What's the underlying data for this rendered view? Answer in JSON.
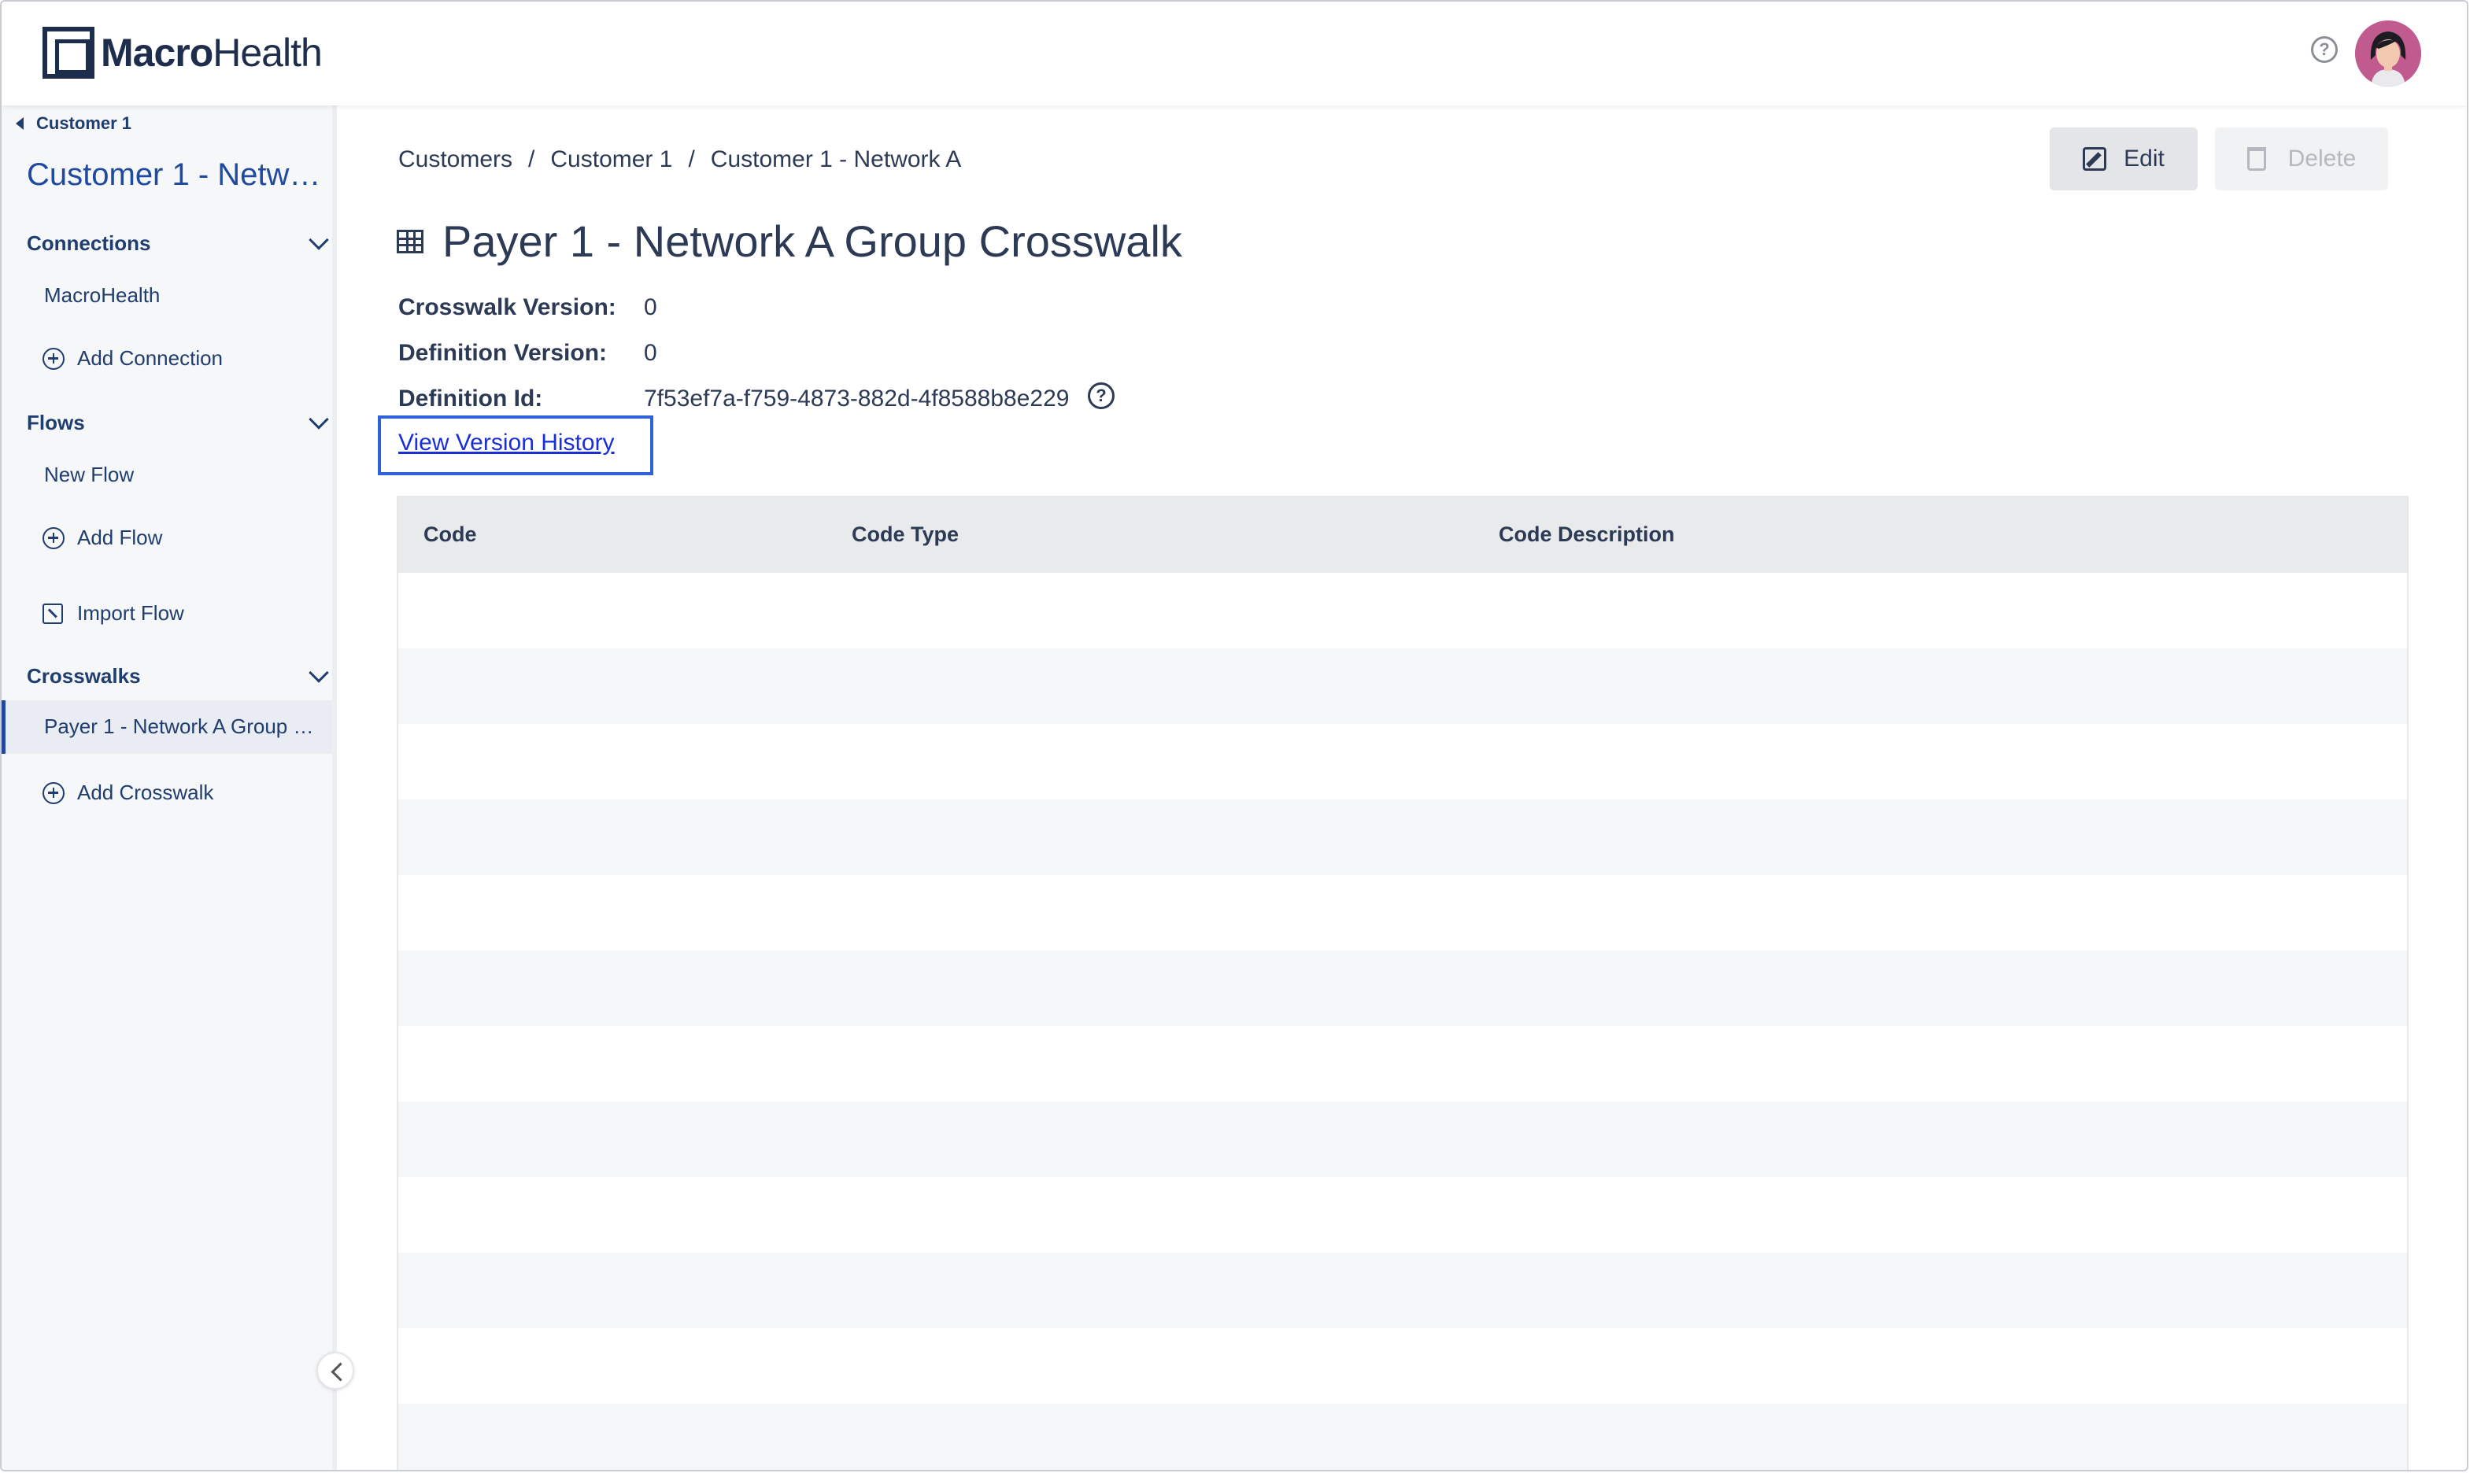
{
  "app": {
    "logo_bold": "Macro",
    "logo_rest": "Health"
  },
  "sidebar": {
    "back_label": "Customer 1",
    "title": "Customer 1 - Network A",
    "sections": {
      "connections": "Connections",
      "flows": "Flows",
      "crosswalks": "Crosswalks"
    },
    "connections_items": [
      "MacroHealth"
    ],
    "add_connection": "Add Connection",
    "flows_items": [
      "New Flow"
    ],
    "add_flow": "Add Flow",
    "import_flow": "Import Flow",
    "crosswalk_items": [
      "Payer 1 - Network A Group Crosswalk"
    ],
    "add_crosswalk": "Add Crosswalk"
  },
  "breadcrumb": [
    "Customers",
    "Customer 1",
    "Customer 1 - Network A"
  ],
  "toolbar": {
    "edit_label": "Edit",
    "delete_label": "Delete"
  },
  "page": {
    "title": "Payer 1 - Network A Group Crosswalk",
    "crosswalk_version_label": "Crosswalk Version:",
    "crosswalk_version": "0",
    "definition_version_label": "Definition Version:",
    "definition_version": "0",
    "definition_id_label": "Definition Id:",
    "definition_id": "7f53ef7a-f759-4873-882d-4f8588b8e229",
    "version_history_link": "View Version History"
  },
  "table": {
    "columns": [
      "Code",
      "Code Type",
      "Code Description"
    ],
    "rows": []
  },
  "icons": {
    "help": "?"
  },
  "colors": {
    "accent": "#1f4aa0",
    "link": "#1a2fd6",
    "focus": "#2f62d9"
  }
}
